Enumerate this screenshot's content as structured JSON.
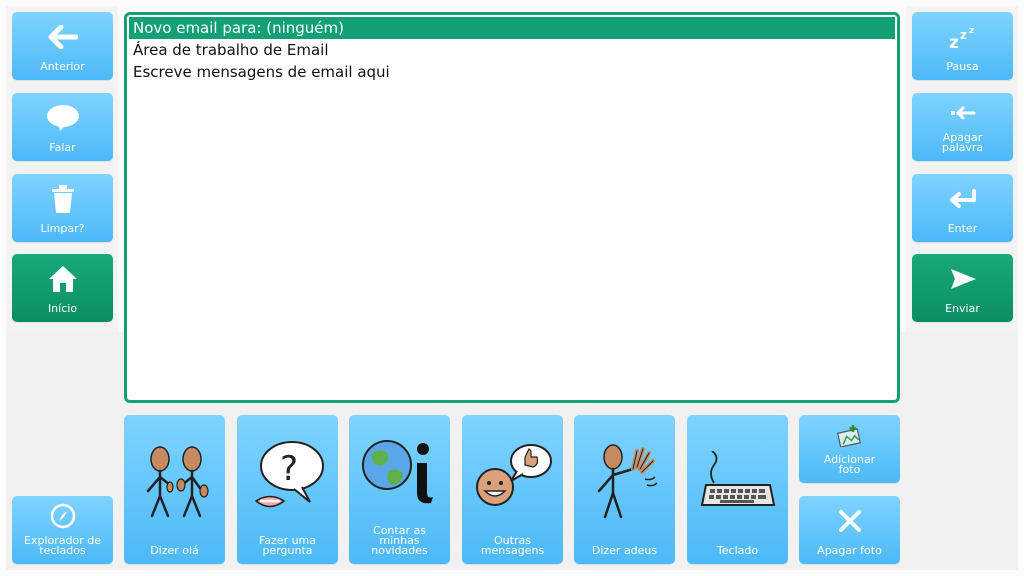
{
  "left_column": {
    "anterior": "Anterior",
    "falar": "Falar",
    "limpar": "Limpar?",
    "inicio": "Início",
    "explorador": "Explorador de\nteclados"
  },
  "right_column": {
    "pausa": "Pausa",
    "apagar_palavra": "Apagar\npalavra",
    "enter": "Enter",
    "enviar": "Enviar"
  },
  "message": {
    "lines": [
      "Novo email para: (ninguém)",
      "Área de trabalho de Email",
      "Escreve mensagens de email aqui"
    ]
  },
  "bottom_tiles": {
    "dizer_ola": "Dizer olá",
    "fazer_pergunta": "Fazer uma\npergunta",
    "contar_novidades": "Contar as\nminhas\nnovidades",
    "outras_mensagens": "Outras\nmensagens",
    "dizer_adeus": "Dizer adeus",
    "teclado": "Teclado",
    "adicionar_foto": "Adicionar\nfoto",
    "apagar_foto": "Apagar foto"
  },
  "colors": {
    "tile_blue": "#5bc3fb",
    "tile_green": "#0f9a70",
    "selection": "#13a077"
  }
}
